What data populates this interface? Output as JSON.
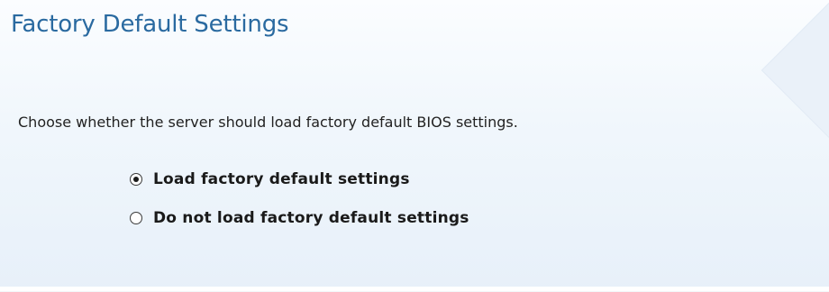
{
  "panel": {
    "title": "Factory Default Settings",
    "description": "Choose whether the server should load factory default BIOS settings."
  },
  "options": [
    {
      "label": "Load factory default settings",
      "selected": true
    },
    {
      "label": "Do not load factory default settings",
      "selected": false
    }
  ],
  "colors": {
    "title": "#2a6aa0",
    "text": "#222222"
  }
}
